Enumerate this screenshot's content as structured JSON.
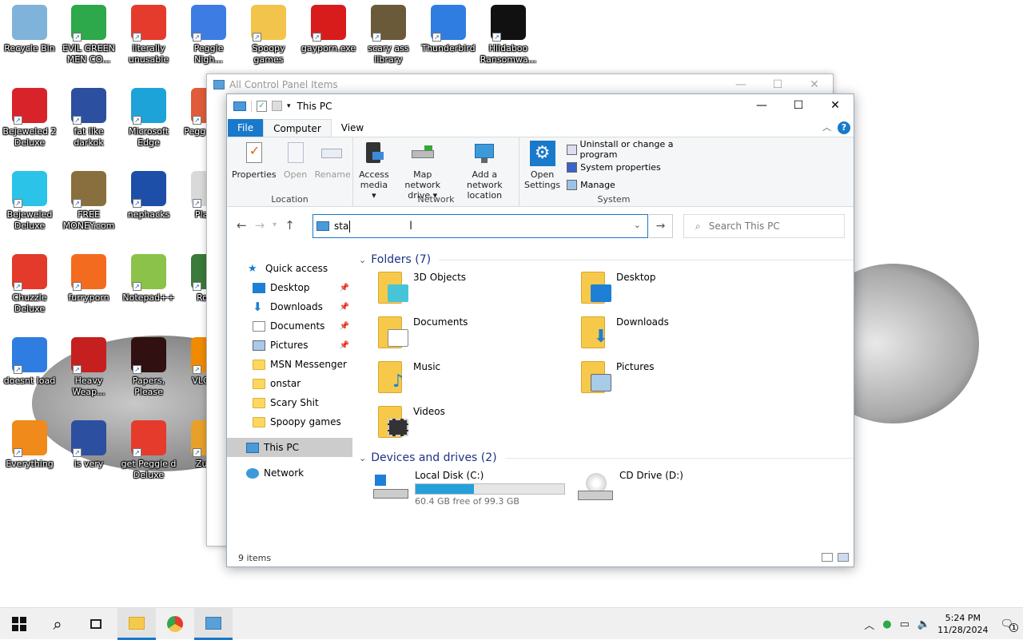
{
  "desktop": {
    "icons": [
      {
        "label": "Recycle Bin",
        "color": "#7fb3d9"
      },
      {
        "label": "EVIL GREEN MEN CO...",
        "color": "#2da84a"
      },
      {
        "label": "literally unusable",
        "color": "#e53b2c"
      },
      {
        "label": "Peggle Nigh...",
        "color": "#3d7ce3"
      },
      {
        "label": "Spoopy games",
        "color": "#f3c44b"
      },
      {
        "label": "gayporn.exe",
        "color": "#d81c1c"
      },
      {
        "label": "scary ass library",
        "color": "#6b5a3a"
      },
      {
        "label": "Thunderbird",
        "color": "#2f7de1"
      },
      {
        "label": "Hildaboo Ransomwa...",
        "color": "#111111"
      },
      {
        "label": "Bejeweled 2 Deluxe",
        "color": "#d8232a"
      },
      {
        "label": "fat like darkok",
        "color": "#2c4fa0"
      },
      {
        "label": "Microsoft Edge",
        "color": "#1ea3d9"
      },
      {
        "label": "Pegg of Wa",
        "color": "#e05b3a"
      },
      {
        "label": "Bejeweled Deluxe",
        "color": "#2bc4e8"
      },
      {
        "label": "FREE MONEY.com",
        "color": "#8a6f3e"
      },
      {
        "label": "nephacks",
        "color": "#1d4fa8"
      },
      {
        "label": "Pla Zo",
        "color": "#d9d9d9"
      },
      {
        "label": "Chuzzle Deluxe",
        "color": "#e33a2b"
      },
      {
        "label": "furryporn",
        "color": "#f36b1f"
      },
      {
        "label": "Notepad++",
        "color": "#8bc34a"
      },
      {
        "label": "Ro Mi",
        "color": "#3a7a3a"
      },
      {
        "label": "doesnt load",
        "color": "#2f7de1"
      },
      {
        "label": "Heavy Weap...",
        "color": "#c61f1f"
      },
      {
        "label": "Papers, Please",
        "color": "#301010"
      },
      {
        "label": "VLC pla",
        "color": "#f08a00"
      },
      {
        "label": "Everything",
        "color": "#f08a1a"
      },
      {
        "label": "is very",
        "color": "#2c4fa0"
      },
      {
        "label": "get Peggle d Deluxe",
        "color": "#e53b2c"
      },
      {
        "label": "Zuma",
        "color": "#e7a12a"
      }
    ]
  },
  "back_window": {
    "title": "All Control Panel Items"
  },
  "explorer": {
    "title": "This PC",
    "controls": {
      "minimize": "—",
      "maximize": "☐",
      "close": "✕"
    },
    "tabs": {
      "file": "File",
      "computer": "Computer",
      "view": "View"
    },
    "ribbon": {
      "location": {
        "label": "Location",
        "properties": "Properties",
        "open": "Open",
        "rename": "Rename"
      },
      "network": {
        "label": "Network",
        "access_media_1": "Access",
        "access_media_2": "media ▾",
        "map_drive_1": "Map network",
        "map_drive_2": "drive ▾",
        "add_location_1": "Add a network",
        "add_location_2": "location"
      },
      "system": {
        "label": "System",
        "open_settings_1": "Open",
        "open_settings_2": "Settings",
        "uninstall": "Uninstall or change a program",
        "system_properties": "System properties",
        "manage": "Manage"
      }
    },
    "address": {
      "value": "sta"
    },
    "search": {
      "placeholder": "Search This PC"
    },
    "nav_pane": {
      "quick_access": "Quick access",
      "desktop": "Desktop",
      "downloads": "Downloads",
      "documents": "Documents",
      "pictures": "Pictures",
      "msn": "MSN Messenger",
      "onstar": "onstar",
      "scary": "Scary Shit",
      "spoopy": "Spoopy games",
      "this_pc": "This PC",
      "network": "Network"
    },
    "folders_header": "Folders (7)",
    "folders": {
      "objects3d": "3D Objects",
      "desktop": "Desktop",
      "documents": "Documents",
      "downloads": "Downloads",
      "music": "Music",
      "pictures": "Pictures",
      "videos": "Videos"
    },
    "devices_header": "Devices and drives (2)",
    "drives": {
      "c_name": "Local Disk (C:)",
      "c_free": "60.4 GB free of 99.3 GB",
      "c_used_fraction": 0.39,
      "d_name": "CD Drive (D:)"
    },
    "status": "9 items",
    "accent": "#1979ca"
  },
  "taskbar": {
    "time": "5:24 PM",
    "date": "11/28/2024",
    "notification_count": "1"
  }
}
